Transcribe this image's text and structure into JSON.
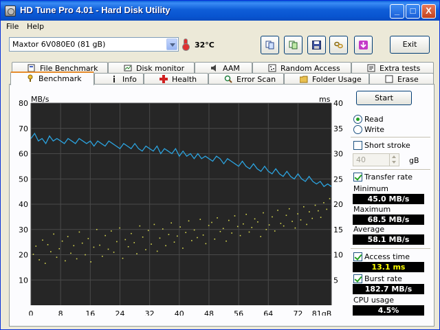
{
  "window": {
    "title": "HD Tune Pro 4.01 - Hard Disk Utility",
    "min": "_",
    "max": "□",
    "close": "X"
  },
  "menu": {
    "file": "File",
    "help": "Help"
  },
  "toolbar": {
    "drive": "Maxtor 6V080E0 (81 gB)",
    "temperature": "32°C",
    "exit": "Exit"
  },
  "tabs_top": [
    "File Benchmark",
    "Disk monitor",
    "AAM",
    "Random Access",
    "Extra tests"
  ],
  "tabs_bottom": [
    "Benchmark",
    "Info",
    "Health",
    "Error Scan",
    "Folder Usage",
    "Erase"
  ],
  "controls": {
    "start": "Start",
    "read": "Read",
    "write": "Write",
    "short_stroke": "Short stroke",
    "stroke_value": "40",
    "stroke_unit": "gB",
    "transfer_rate": "Transfer rate",
    "minimum_label": "Minimum",
    "minimum": "45.0 MB/s",
    "maximum_label": "Maximum",
    "maximum": "68.5 MB/s",
    "average_label": "Average",
    "average": "58.1 MB/s",
    "access_time_label": "Access time",
    "access_time": "13.1 ms",
    "burst_rate_label": "Burst rate",
    "burst_rate": "182.7 MB/s",
    "cpu_label": "CPU usage",
    "cpu": "4.5%",
    "read_selected": true,
    "short_stroke_checked": false,
    "transfer_rate_checked": true,
    "access_time_checked": true,
    "burst_rate_checked": true
  },
  "colors": {
    "transfer_line": "#2ca4e0",
    "access_dots": "#d8d850",
    "plot_bg": "#262626",
    "grid": "#4a4a4a"
  },
  "chart_data": {
    "type": "line",
    "xlabel": "gB",
    "ylabel_left": "MB/s",
    "ylabel_right": "ms",
    "x_ticks": [
      0,
      8,
      16,
      24,
      32,
      40,
      48,
      56,
      64,
      72,
      81
    ],
    "x_tick_labels": [
      "0",
      "8",
      "16",
      "24",
      "32",
      "40",
      "48",
      "56",
      "64",
      "72",
      "81gB"
    ],
    "y_left_ticks": [
      10,
      20,
      30,
      40,
      50,
      60,
      70,
      80
    ],
    "y_right_ticks": [
      5,
      10,
      15,
      20,
      25,
      30,
      35,
      40
    ],
    "xlim": [
      0,
      81
    ],
    "ylim_left": [
      0,
      80
    ],
    "ylim_right": [
      0,
      40
    ],
    "grid": true,
    "series": [
      {
        "name": "Transfer rate",
        "axis": "left",
        "x": [
          0,
          1,
          2,
          3,
          4,
          5,
          6,
          7,
          8,
          9,
          10,
          11,
          12,
          13,
          14,
          15,
          16,
          17,
          18,
          19,
          20,
          21,
          22,
          23,
          24,
          25,
          26,
          27,
          28,
          29,
          30,
          31,
          32,
          33,
          34,
          35,
          36,
          37,
          38,
          39,
          40,
          41,
          42,
          43,
          44,
          45,
          46,
          47,
          48,
          49,
          50,
          51,
          52,
          53,
          54,
          55,
          56,
          57,
          58,
          59,
          60,
          61,
          62,
          63,
          64,
          65,
          66,
          67,
          68,
          69,
          70,
          71,
          72,
          73,
          74,
          75,
          76,
          77,
          78,
          79,
          80,
          81
        ],
        "values": [
          66,
          68,
          65,
          66,
          64,
          67,
          65,
          66,
          65,
          64,
          66,
          65,
          64,
          66,
          65,
          64,
          65,
          63,
          65,
          64,
          63,
          65,
          64,
          63,
          62,
          64,
          63,
          62,
          64,
          62,
          61,
          63,
          62,
          61,
          63,
          60,
          62,
          61,
          60,
          62,
          59,
          61,
          59,
          60,
          58,
          60,
          58,
          59,
          58,
          57,
          59,
          58,
          56,
          58,
          57,
          56,
          55,
          57,
          55,
          54,
          56,
          54,
          53,
          55,
          53,
          52,
          54,
          52,
          51,
          53,
          51,
          50,
          52,
          50,
          49,
          51,
          49,
          48,
          49,
          47,
          48,
          47
        ]
      },
      {
        "name": "Access time",
        "axis": "right",
        "type": "scatter",
        "x": [
          0.5,
          1.2,
          2.1,
          3.0,
          3.7,
          4.4,
          5.2,
          6.0,
          6.8,
          7.5,
          8.3,
          9.1,
          9.8,
          10.6,
          11.4,
          12.2,
          12.9,
          13.7,
          14.5,
          15.3,
          16.0,
          16.8,
          17.6,
          18.4,
          19.1,
          19.9,
          20.7,
          21.5,
          22.2,
          23.0,
          23.8,
          24.6,
          25.3,
          26.1,
          26.9,
          27.7,
          28.4,
          29.2,
          30.0,
          30.8,
          31.5,
          32.3,
          33.1,
          33.9,
          34.6,
          35.4,
          36.2,
          37.0,
          37.7,
          38.5,
          39.3,
          40.1,
          40.8,
          41.6,
          42.4,
          43.2,
          43.9,
          44.7,
          45.5,
          46.3,
          47.0,
          47.8,
          48.6,
          49.4,
          50.1,
          50.9,
          51.7,
          52.5,
          53.2,
          54.0,
          54.8,
          55.6,
          56.3,
          57.1,
          57.9,
          58.7,
          59.4,
          60.2,
          61.0,
          61.8,
          62.5,
          63.3,
          64.1,
          64.9,
          65.6,
          66.4,
          67.2,
          68.0,
          68.7,
          69.5,
          70.3,
          71.1,
          71.8,
          72.6,
          73.4,
          74.2,
          74.9,
          75.7,
          76.5,
          77.3,
          78.0,
          78.8,
          79.6,
          80.4
        ],
        "values": [
          10.2,
          11.8,
          9.1,
          13.0,
          8.4,
          12.1,
          10.7,
          14.2,
          9.6,
          11.3,
          12.8,
          8.9,
          13.7,
          10.4,
          11.9,
          9.3,
          14.6,
          12.4,
          10.1,
          13.3,
          8.7,
          11.6,
          15.1,
          12.0,
          9.8,
          13.9,
          11.2,
          14.8,
          10.6,
          12.7,
          15.4,
          9.4,
          13.1,
          11.7,
          14.3,
          12.5,
          10.3,
          15.8,
          13.6,
          11.1,
          14.9,
          12.2,
          16.1,
          10.8,
          13.4,
          15.2,
          11.9,
          14.1,
          16.4,
          12.6,
          13.8,
          15.6,
          11.4,
          14.5,
          16.8,
          12.9,
          15.0,
          13.5,
          17.1,
          14.0,
          12.3,
          15.9,
          16.5,
          13.2,
          17.4,
          14.7,
          15.3,
          12.8,
          16.9,
          14.4,
          17.8,
          15.7,
          13.9,
          16.2,
          18.1,
          14.6,
          15.5,
          17.2,
          16.6,
          13.7,
          18.4,
          15.1,
          16.0,
          17.6,
          14.8,
          18.9,
          16.3,
          15.8,
          17.9,
          19.2,
          16.7,
          15.4,
          18.2,
          17.0,
          19.6,
          16.1,
          18.6,
          17.3,
          19.9,
          18.8,
          17.5,
          20.4,
          19.1,
          21.2
        ]
      }
    ]
  }
}
